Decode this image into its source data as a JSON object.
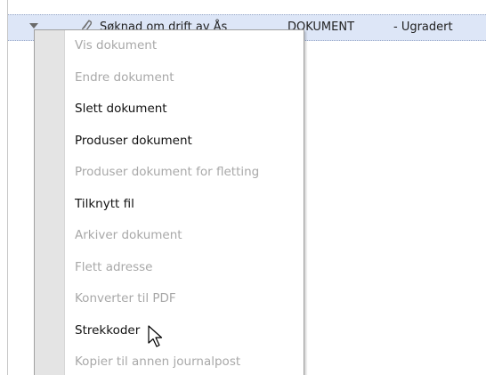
{
  "document_row": {
    "title": "Søknad om drift av Ås",
    "type": "DOKUMENT",
    "grading": "- Ugradert"
  },
  "context_menu": {
    "items": [
      {
        "label": "Vis dokument",
        "enabled": false
      },
      {
        "label": "Endre dokument",
        "enabled": false
      },
      {
        "label": "Slett dokument",
        "enabled": true
      },
      {
        "label": "Produser dokument",
        "enabled": true
      },
      {
        "label": "Produser dokument for fletting",
        "enabled": false
      },
      {
        "label": "Tilknytt fil",
        "enabled": true
      },
      {
        "label": "Arkiver dokument",
        "enabled": false
      },
      {
        "label": "Flett adresse",
        "enabled": false
      },
      {
        "label": "Konverter til PDF",
        "enabled": false
      },
      {
        "label": "Strekkoder",
        "enabled": true
      },
      {
        "label": "Kopier til annen journalpost",
        "enabled": false
      }
    ]
  },
  "icons": {
    "expander": "chevron-down-icon",
    "attachment": "paperclip-icon",
    "cursor": "mouse-pointer-icon"
  },
  "colors": {
    "row_highlight": "#dde6f7",
    "menu_gutter": "#e4e4e4",
    "enabled_text": "#111111",
    "disabled_text": "#a8a8a8"
  }
}
